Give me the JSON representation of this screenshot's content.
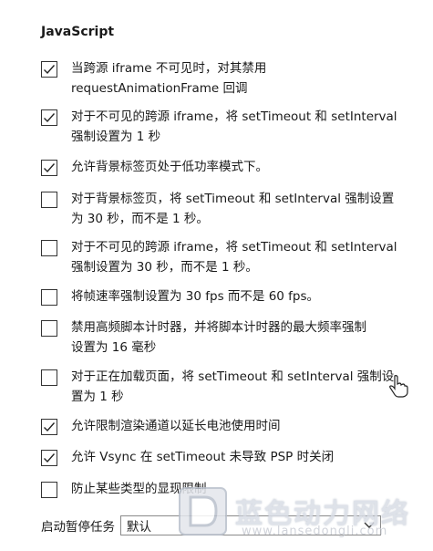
{
  "section": {
    "title": "JavaScript"
  },
  "options": [
    {
      "label_lines": [
        "当跨源 iframe 不可见时，对其禁用",
        "requestAnimationFrame 回调"
      ],
      "checked": true
    },
    {
      "label_lines": [
        "对于不可见的跨源 iframe，将 setTimeout 和 setInterval",
        "强制设置为 1 秒"
      ],
      "checked": true
    },
    {
      "label_lines": [
        "允许背景标签页处于低功率模式下。"
      ],
      "checked": true
    },
    {
      "label_lines": [
        "对于背景标签页，将 setTimeout 和 setInterval 强制设置",
        "为 30 秒，而不是 1 秒。"
      ],
      "checked": false
    },
    {
      "label_lines": [
        "对于不可见的跨源 iframe，将 setTimeout 和 setInterval",
        "强制设置为 30 秒，而不是 1 秒。"
      ],
      "checked": false
    },
    {
      "label_lines": [
        "将帧速率强制设置为 30 fps 而不是 60 fps。"
      ],
      "checked": false
    },
    {
      "label_lines": [
        "禁用高频脚本计时器，并将脚本计时器的最大频率强制",
        "设置为 16 毫秒"
      ],
      "checked": false
    },
    {
      "label_lines": [
        "对于正在加载页面，将 setTimeout 和 setInterval 强制设",
        "置为 1 秒"
      ],
      "checked": false
    },
    {
      "label_lines": [
        "允许限制渲染通道以延长电池使用时间"
      ],
      "checked": true
    },
    {
      "label_lines": [
        "允许 Vsync 在 setTimeout 未导致 PSP 时关闭"
      ],
      "checked": true
    },
    {
      "label_lines": [
        "防止某些类型的显现限制"
      ],
      "checked": false
    }
  ],
  "startup": {
    "label": "启动暂停任务",
    "selected_value": "默认"
  },
  "watermark": {
    "text": "蓝色动力网络",
    "url": "www.lansedongli.com"
  },
  "icons": {
    "check": "check-icon",
    "dropdown": "chevron-down-icon",
    "cursor": "hand-cursor-icon"
  },
  "colors": {
    "border": "#333333",
    "text": "#1a1a1a",
    "background": "#ffffff"
  }
}
